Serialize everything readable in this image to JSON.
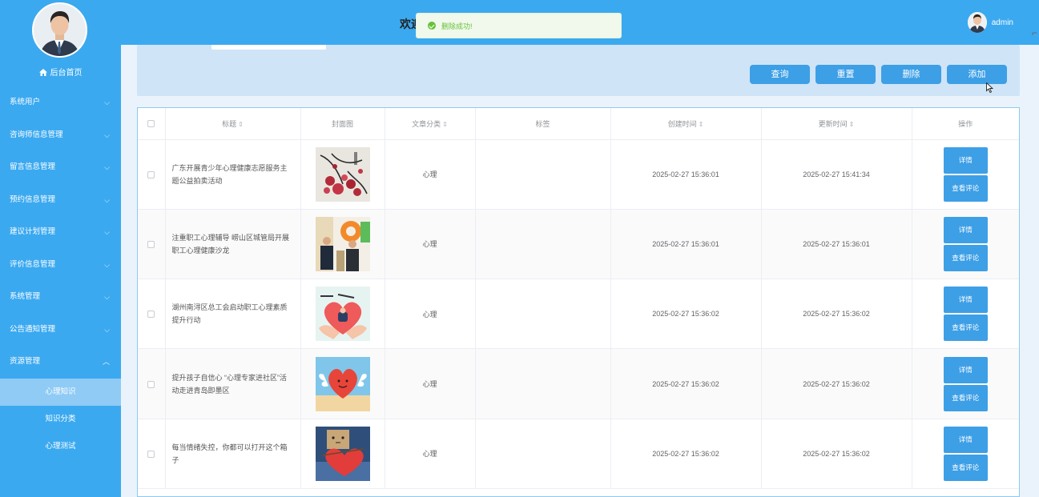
{
  "sidebar": {
    "home_label": "后台首页",
    "menu": [
      {
        "label": "系统用户"
      },
      {
        "label": "咨询师信息管理"
      },
      {
        "label": "留言信息管理"
      },
      {
        "label": "预约信息管理"
      },
      {
        "label": "建议计划管理"
      },
      {
        "label": "评价信息管理"
      },
      {
        "label": "系统管理"
      },
      {
        "label": "公告通知管理"
      },
      {
        "label": "资源管理"
      }
    ],
    "submenu": [
      {
        "label": "心理知识",
        "active": true
      },
      {
        "label": "知识分类"
      },
      {
        "label": "心理测试"
      }
    ]
  },
  "header": {
    "title": "欢迎",
    "admin_name": "admin"
  },
  "toast": {
    "message": "删除成功!",
    "color": "#67c23a"
  },
  "toolbar": {
    "query_label": "查询",
    "reset_label": "重置",
    "delete_label": "删除",
    "add_label": "添加"
  },
  "table": {
    "headers": {
      "title": "标题",
      "cover": "封面图",
      "category": "文章分类",
      "tags": "标签",
      "created": "创建时间",
      "updated": "更新时间",
      "actions": "操作"
    },
    "detail_label": "详情",
    "comments_label": "查看评论",
    "rows": [
      {
        "title": "广东开展青少年心理健康志愿服务主题公益拍卖活动",
        "category": "心理",
        "tags": "",
        "created": "2025-02-27 15:36:01",
        "updated": "2025-02-27 15:41:34",
        "cover": "flower-painting"
      },
      {
        "title": "注重职工心理辅导 崂山区城管局开展职工心理健康沙龙",
        "category": "心理",
        "tags": "",
        "created": "2025-02-27 15:36:01",
        "updated": "2025-02-27 15:36:01",
        "cover": "people-photo"
      },
      {
        "title": "湖州南浔区总工会启动职工心理素质提升行动",
        "category": "心理",
        "tags": "",
        "created": "2025-02-27 15:36:02",
        "updated": "2025-02-27 15:36:02",
        "cover": "heart-hands"
      },
      {
        "title": "提升孩子自信心 “心理专家进社区”活动走进青岛即墨区",
        "category": "心理",
        "tags": "",
        "created": "2025-02-27 15:36:02",
        "updated": "2025-02-27 15:36:02",
        "cover": "heart-wings"
      },
      {
        "title": "每当情绪失控，你都可以打开这个箱子",
        "category": "心理",
        "tags": "",
        "created": "2025-02-27 15:36:02",
        "updated": "2025-02-27 15:36:02",
        "cover": "box-heart"
      }
    ]
  },
  "colors": {
    "primary": "#3ba9f0",
    "button": "#3d9fe6",
    "active_sub": "#8fcbf5",
    "success": "#67c23a"
  }
}
